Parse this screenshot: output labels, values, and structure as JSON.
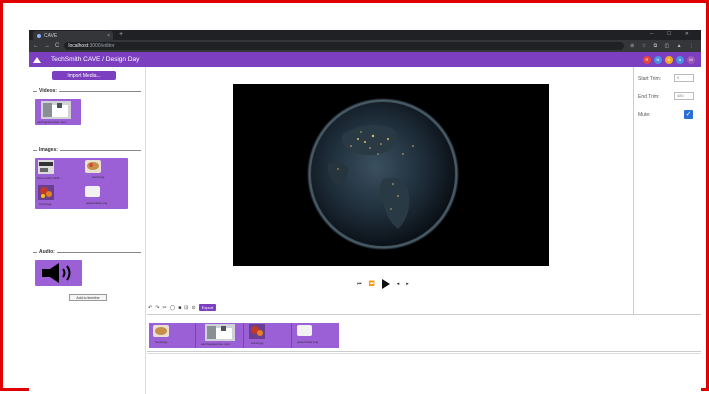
{
  "browser": {
    "tab_title": "CAVE",
    "tab_close": "×",
    "new_tab": "+",
    "window_controls": "─ ☐ ✕",
    "nav": [
      "←",
      "→",
      "C"
    ],
    "url_host": "localhost",
    "url_path": ":3000/editor",
    "right_icons": "⊘ ☆ ⧉ ◫ ▲ ⋮"
  },
  "app": {
    "title": "TechSmith CAVE / Design Day",
    "avatars": [
      {
        "initial": "R",
        "color": "#e8463a"
      },
      {
        "initial": "N",
        "color": "#4a90e2"
      },
      {
        "initial": "K",
        "color": "#f5a623"
      },
      {
        "initial": "A",
        "color": "#4a90e2"
      },
      {
        "initial": "M",
        "color": "#9b59b6"
      }
    ],
    "accent": "#7b3fbf"
  },
  "sidebar": {
    "import_label": "Import Media...",
    "videos_label": "Videos:",
    "images_label": "Images:",
    "audio_label": "Audio:",
    "add_to_timeline": "Add to timeline",
    "video_items": [
      {
        "caption": "earthquakevideo.mp4"
      }
    ],
    "image_items": [
      {
        "caption": "Screenshot 2021..."
      },
      {
        "caption": "food2.jpg"
      },
      {
        "caption": "food3.jpg"
      },
      {
        "caption": "placeholder.png"
      }
    ],
    "audio_items": [
      {
        "icon": "speaker-icon"
      }
    ]
  },
  "player": {
    "controls": [
      "⏮",
      "⏪",
      "⏵",
      "◂",
      "▸"
    ]
  },
  "toolbar": {
    "icons": [
      "↶",
      "↷",
      "✂",
      "◯",
      "■",
      "⊡",
      "⊙"
    ],
    "export_label": "Export"
  },
  "right_panel": {
    "start_trim_label": "Start Trim:",
    "start_trim_value": "0",
    "end_trim_label": "End Trim:",
    "end_trim_value": "480",
    "mute_label": "Mute:",
    "mute_checked": "✓"
  },
  "timeline": {
    "clips": [
      {
        "caption": "food2.jpg"
      },
      {
        "caption": "earthquakevideo.mp4"
      },
      {
        "caption": "food3.jpg"
      },
      {
        "caption": "placeholder.png"
      }
    ]
  }
}
